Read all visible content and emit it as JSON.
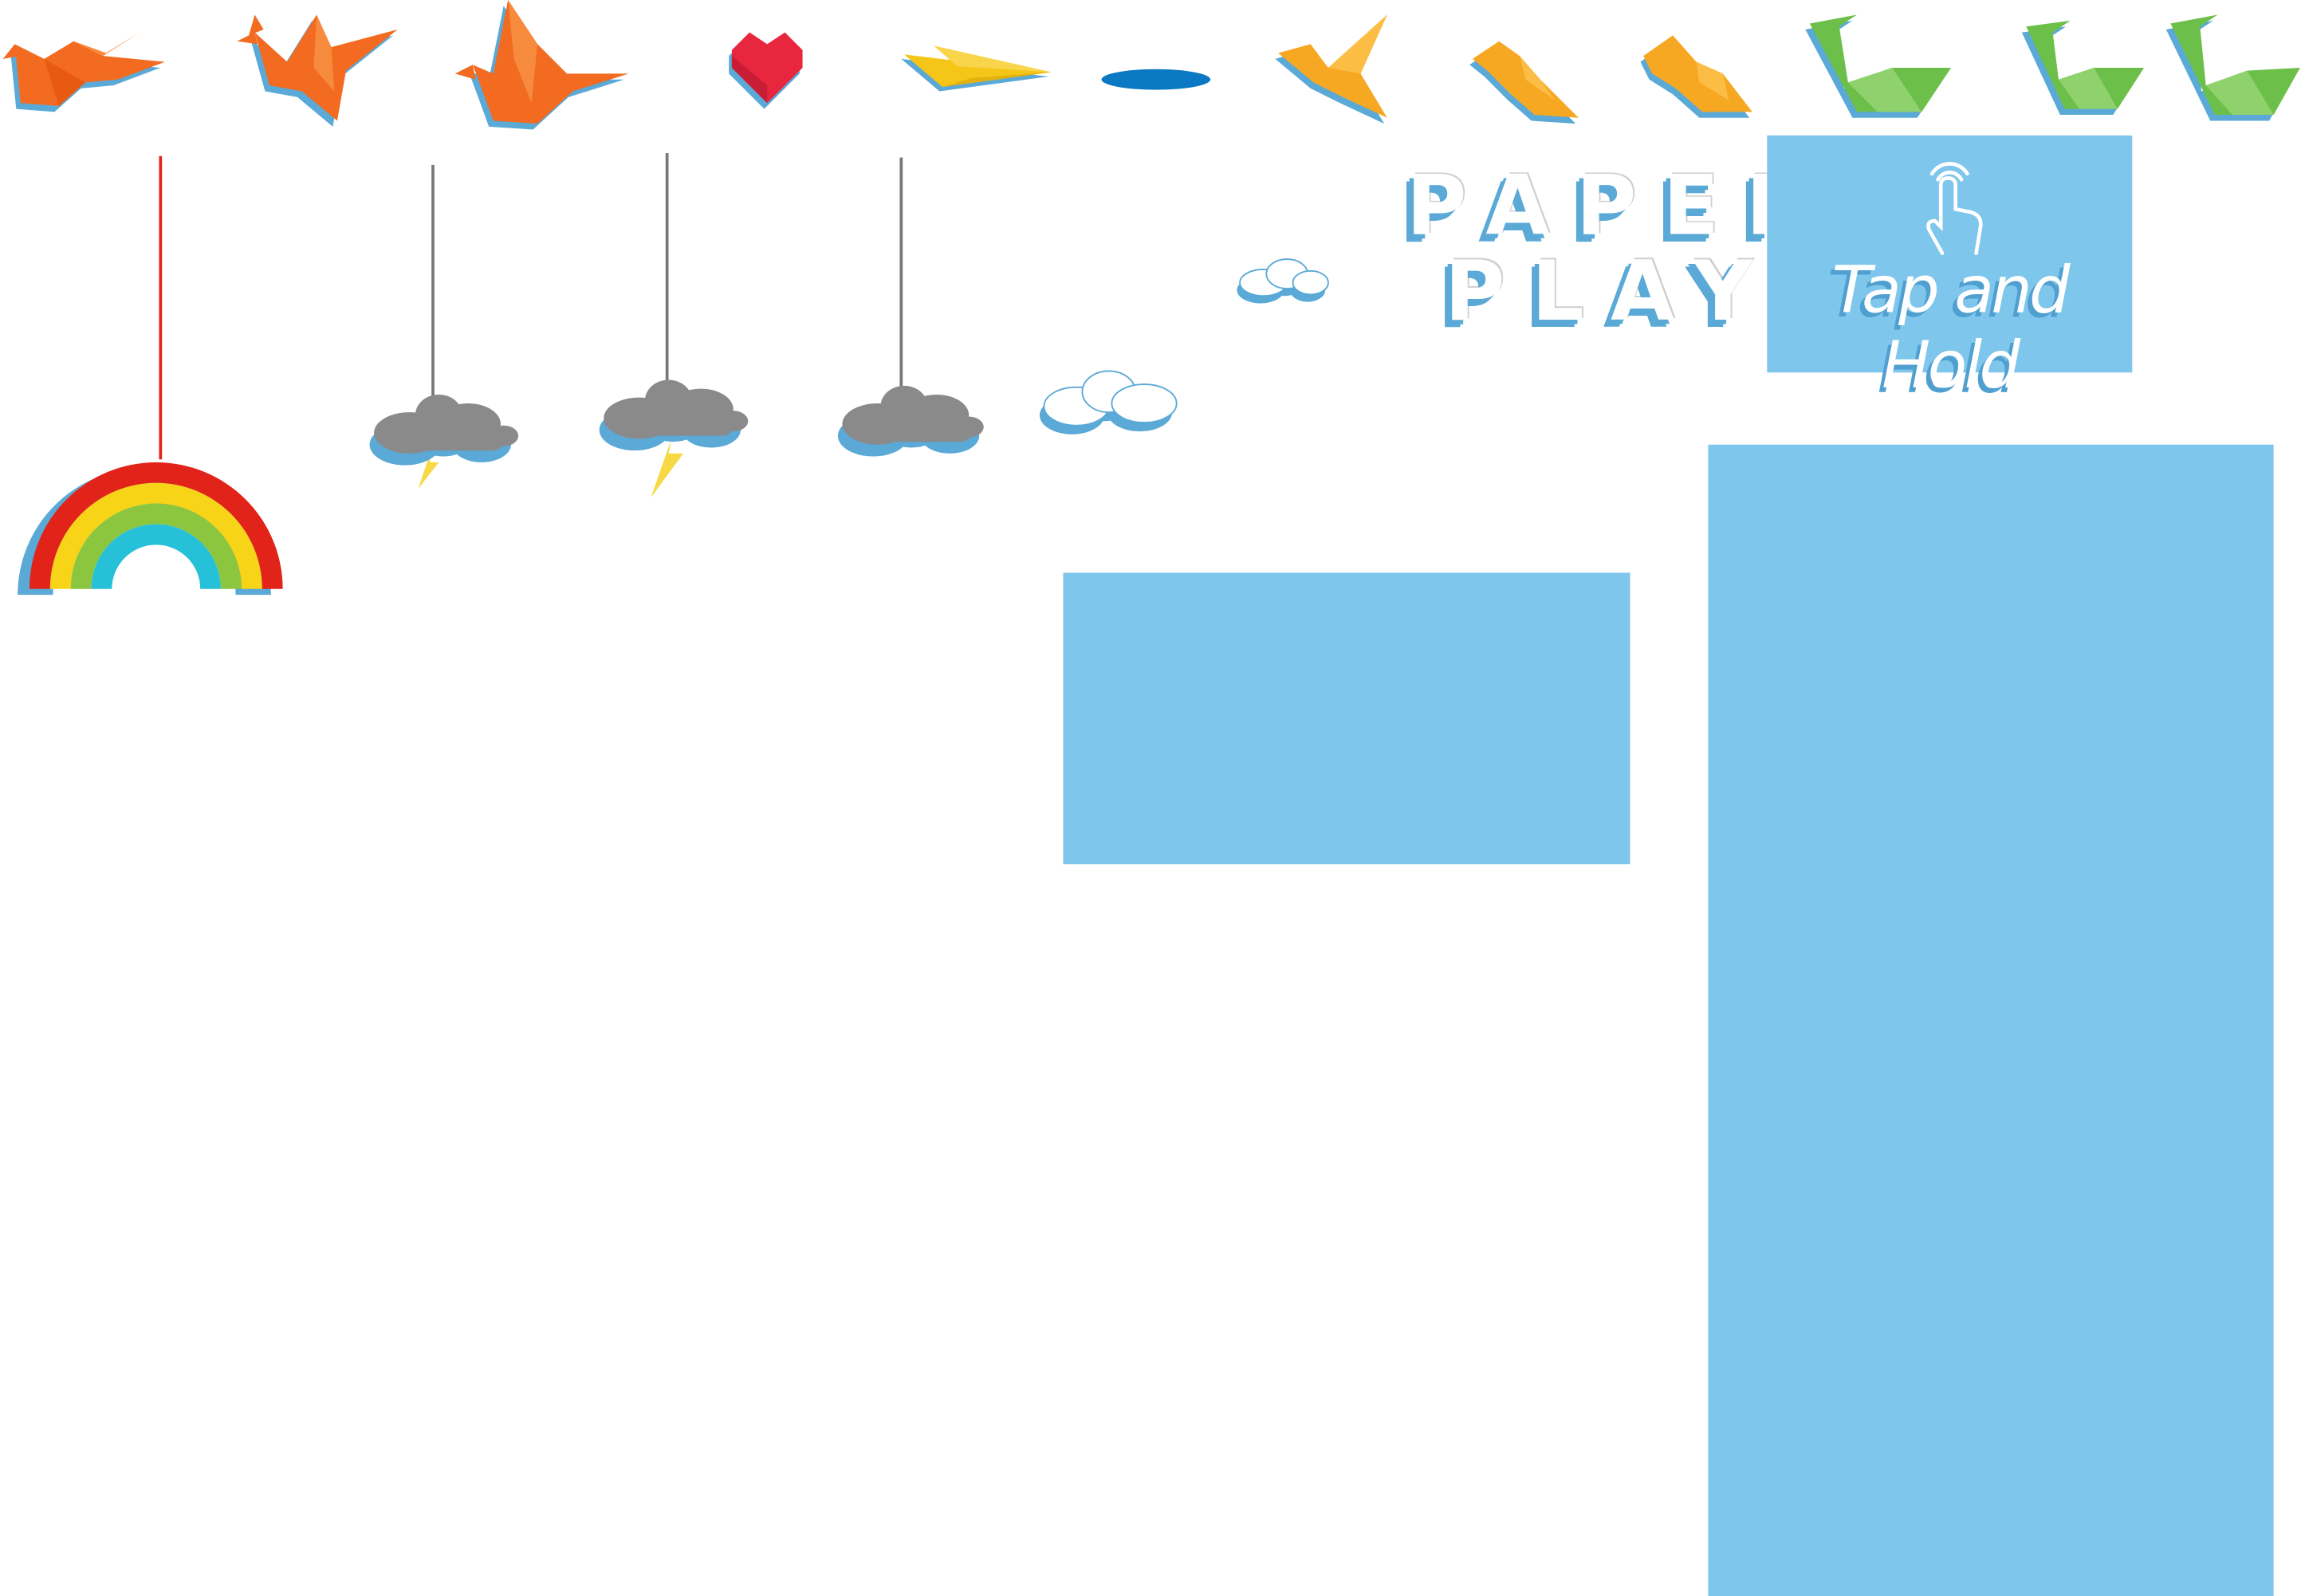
{
  "sheet": {
    "background": "#ffffff",
    "panel_color": "#7ec6ec",
    "shadow_color": "#5aa9d6"
  },
  "logo": {
    "line1": "PAPER",
    "line2": "PLAY"
  },
  "tap_button": {
    "label": "Tap and Hold",
    "icon": "finger-tap-icon"
  },
  "sprites": [
    {
      "name": "orange-dragon-frame-1",
      "icon": "origami-dragon-icon",
      "color": "#f26b21"
    },
    {
      "name": "orange-dragon-frame-2",
      "icon": "origami-dragon-icon",
      "color": "#f26b21"
    },
    {
      "name": "orange-dragon-frame-3",
      "icon": "origami-dragon-icon",
      "color": "#f26b21"
    },
    {
      "name": "red-heart",
      "icon": "heart-icon",
      "color": "#e8263e"
    },
    {
      "name": "paper-plane",
      "icon": "paper-plane-icon",
      "color": "#f5c518"
    },
    {
      "name": "blue-platform",
      "icon": "ellipse-icon",
      "color": "#0a78c2"
    },
    {
      "name": "yellow-bird-frame-1",
      "icon": "origami-bird-icon",
      "color": "#f7a823"
    },
    {
      "name": "yellow-bird-frame-2",
      "icon": "origami-bird-icon",
      "color": "#f7a823"
    },
    {
      "name": "yellow-bird-frame-3",
      "icon": "origami-bird-icon",
      "color": "#f7a823"
    },
    {
      "name": "green-swan-frame-1",
      "icon": "origami-swan-icon",
      "color": "#6cc04a"
    },
    {
      "name": "green-swan-frame-2",
      "icon": "origami-swan-icon",
      "color": "#6cc04a"
    },
    {
      "name": "green-swan-frame-3",
      "icon": "origami-swan-icon",
      "color": "#6cc04a"
    }
  ],
  "hanging": [
    {
      "name": "hanging-rainbow",
      "icon": "rainbow-icon",
      "string_color": "#e2231a"
    },
    {
      "name": "storm-cloud-1",
      "icon": "storm-cloud-icon",
      "string_color": "#777777"
    },
    {
      "name": "storm-cloud-2",
      "icon": "storm-cloud-icon",
      "string_color": "#777777"
    },
    {
      "name": "grey-cloud",
      "icon": "cloud-icon",
      "string_color": "#777777"
    }
  ],
  "rainbow_colors": [
    "#e2231a",
    "#f7d417",
    "#8cc63f",
    "#26c0d8"
  ],
  "white_clouds": [
    {
      "name": "small-white-cloud",
      "icon": "cloud-icon"
    },
    {
      "name": "white-cloud",
      "icon": "cloud-icon"
    }
  ]
}
